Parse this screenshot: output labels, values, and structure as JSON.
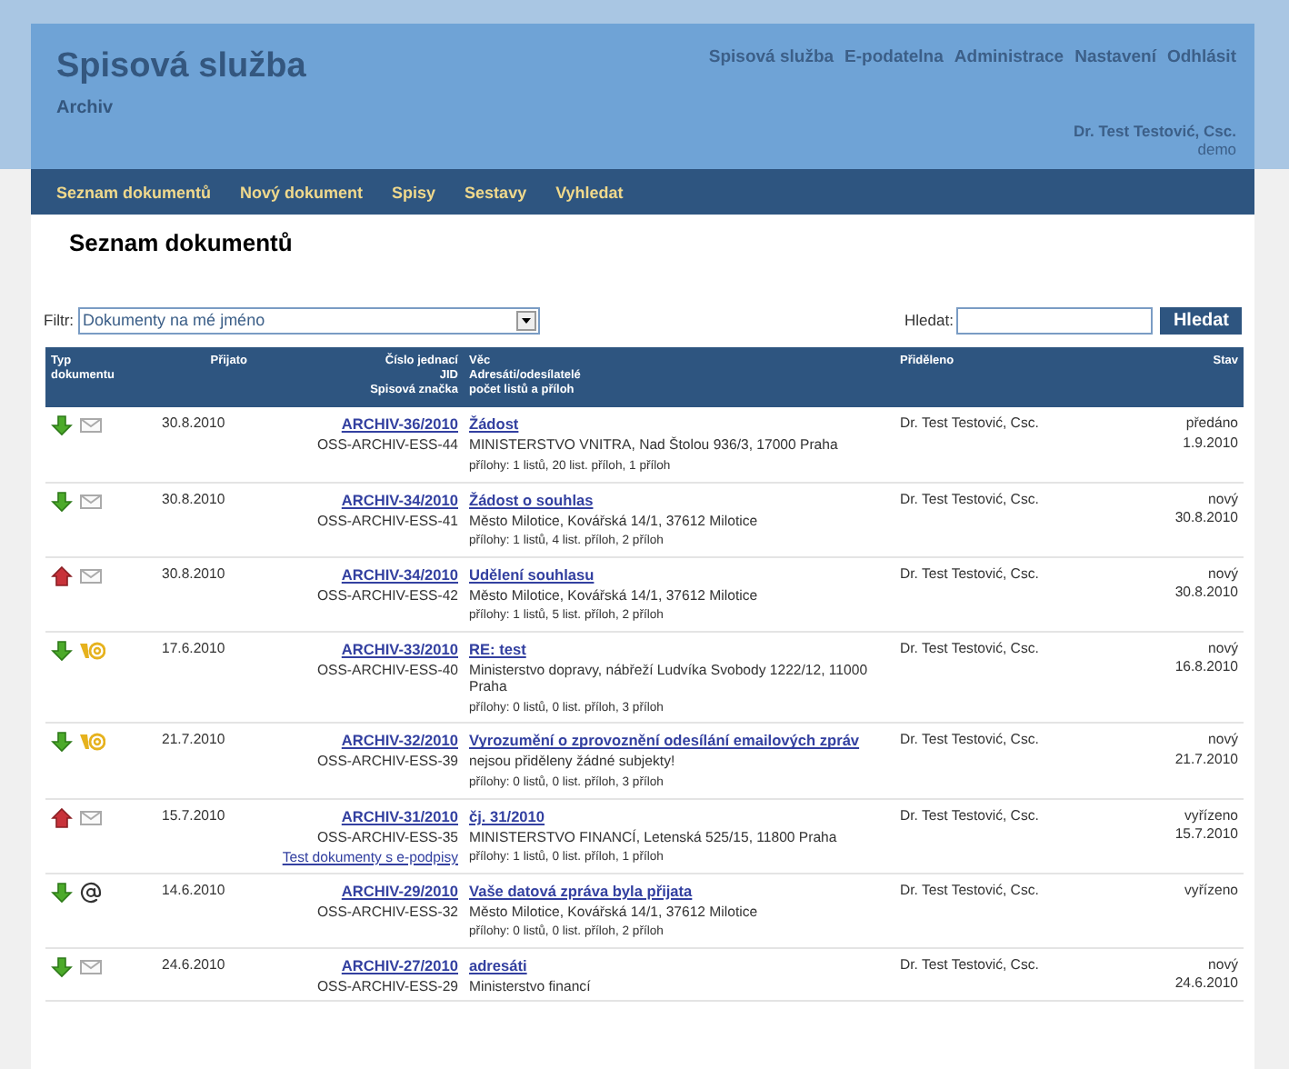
{
  "header": {
    "title": "Spisová služba",
    "subtitle": "Archiv",
    "top_links": [
      "Spisová služba",
      "E-podatelna",
      "Administrace",
      "Nastavení",
      "Odhlásit"
    ],
    "user": {
      "name": "Dr. Test Testović, Csc.",
      "login": "demo"
    }
  },
  "nav": [
    {
      "label": "Seznam dokumentů"
    },
    {
      "label": "Nový dokument"
    },
    {
      "label": "Spisy"
    },
    {
      "label": "Sestavy"
    },
    {
      "label": "Vyhledat"
    }
  ],
  "page_title": "Seznam dokumentů",
  "filter": {
    "label": "Filtr:",
    "value": "Dokumenty na mé jméno"
  },
  "search": {
    "label": "Hledat:",
    "button": "Hledat"
  },
  "table": {
    "columns": [
      {
        "lines": [
          "Typ",
          "dokumentu"
        ]
      },
      {
        "lines": [
          "Přijato"
        ]
      },
      {
        "lines": [
          "Číslo jednací",
          "JID",
          "Spisová značka"
        ]
      },
      {
        "lines": [
          "Věc",
          "Adresáti/odesílatelé",
          "počet listů a příloh"
        ]
      },
      {
        "lines": [
          "Přiděleno"
        ]
      },
      {
        "lines": [
          "Stav"
        ]
      }
    ],
    "rows": [
      {
        "icons": [
          {
            "kind": "incoming"
          },
          {
            "kind": "mail"
          }
        ],
        "received": "30.8.2010",
        "number": "ARCHIV-36/2010",
        "jid": "OSS-ARCHIV-ESS-44",
        "subject": "Žádost",
        "party": "MINISTERSTVO VNITRA, Nad Štolou 936/3, 17000 Praha",
        "attachments": "přílohy: 1 listů, 20 list. příloh, 1 příloh",
        "assigned": "Dr. Test Testović, Csc.",
        "status": "předáno",
        "status_date": "1.9.2010"
      },
      {
        "icons": [
          {
            "kind": "incoming"
          },
          {
            "kind": "mail"
          }
        ],
        "received": "30.8.2010",
        "number": "ARCHIV-34/2010",
        "jid": "OSS-ARCHIV-ESS-41",
        "subject": "Žádost o souhlas",
        "party": "Město Milotice, Kovářská 14/1, 37612 Milotice",
        "attachments": "přílohy: 1 listů, 4 list. příloh, 2 příloh",
        "assigned": "Dr. Test Testović, Csc.",
        "status": "nový",
        "status_date": "30.8.2010"
      },
      {
        "icons": [
          {
            "kind": "outgoing"
          },
          {
            "kind": "mail"
          }
        ],
        "received": "30.8.2010",
        "number": "ARCHIV-34/2010",
        "jid": "OSS-ARCHIV-ESS-42",
        "subject": "Udělení souhlasu",
        "party": "Město Milotice, Kovářská 14/1, 37612 Milotice",
        "attachments": "přílohy: 1 listů, 5 list. příloh, 2 příloh",
        "assigned": "Dr. Test Testović, Csc.",
        "status": "nový",
        "status_date": "30.8.2010"
      },
      {
        "icons": [
          {
            "kind": "incoming"
          },
          {
            "kind": "email"
          }
        ],
        "received": "17.6.2010",
        "number": "ARCHIV-33/2010",
        "jid": "OSS-ARCHIV-ESS-40",
        "subject": "RE: test",
        "party": "Ministerstvo dopravy, nábřeží Ludvíka Svobody 1222/12, 11000 Praha",
        "attachments": "přílohy: 0 listů, 0 list. příloh, 3 příloh",
        "assigned": "Dr. Test Testović, Csc.",
        "status": "nový",
        "status_date": "16.8.2010"
      },
      {
        "icons": [
          {
            "kind": "incoming"
          },
          {
            "kind": "email"
          }
        ],
        "received": "21.7.2010",
        "number": "ARCHIV-32/2010",
        "jid": "OSS-ARCHIV-ESS-39",
        "subject": "Vyrozumění o zprovoznění odesílání emailových zpráv",
        "party": "nejsou přiděleny žádné subjekty!",
        "attachments": "přílohy: 0 listů, 0 list. příloh, 3 příloh",
        "assigned": "Dr. Test Testović, Csc.",
        "status": "nový",
        "status_date": "21.7.2010"
      },
      {
        "icons": [
          {
            "kind": "outgoing"
          },
          {
            "kind": "mail"
          }
        ],
        "received": "15.7.2010",
        "number": "ARCHIV-31/2010",
        "jid": "OSS-ARCHIV-ESS-35",
        "file_link": "Test dokumenty s e-podpisy",
        "subject": "čj. 31/2010",
        "party": "MINISTERSTVO FINANCÍ, Letenská 525/15, 11800 Praha",
        "attachments": "přílohy: 1 listů, 0 list. příloh, 1 příloh",
        "assigned": "Dr. Test Testović, Csc.",
        "status": "vyřízeno",
        "status_date": "15.7.2010"
      },
      {
        "icons": [
          {
            "kind": "incoming"
          },
          {
            "kind": "databox"
          }
        ],
        "received": "14.6.2010",
        "number": "ARCHIV-29/2010",
        "jid": "OSS-ARCHIV-ESS-32",
        "subject": "Vaše datová zpráva byla přijata",
        "party": "Město Milotice, Kovářská 14/1, 37612 Milotice",
        "attachments": "přílohy: 0 listů, 0 list. příloh, 2 příloh",
        "assigned": "Dr. Test Testović, Csc.",
        "status": "vyřízeno"
      },
      {
        "icons": [
          {
            "kind": "incoming"
          },
          {
            "kind": "mail"
          }
        ],
        "received": "24.6.2010",
        "number": "ARCHIV-27/2010",
        "jid": "OSS-ARCHIV-ESS-29",
        "subject": "adresáti",
        "party": "Ministerstvo financí",
        "assigned": "Dr. Test Testović, Csc.",
        "status": "nový",
        "status_date": "24.6.2010"
      }
    ]
  }
}
